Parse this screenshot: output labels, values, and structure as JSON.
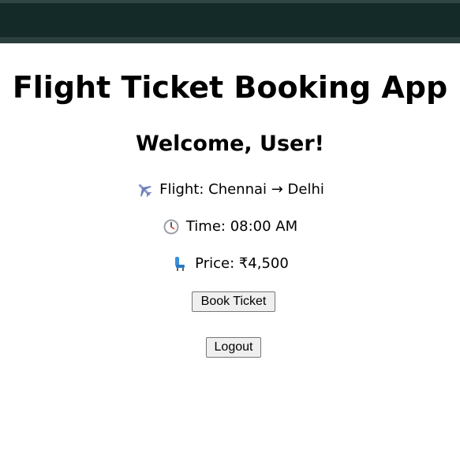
{
  "app": {
    "title": "Flight Ticket Booking App",
    "welcome": "Welcome, User!"
  },
  "flight_info": {
    "flight_label": "Flight: Chennai → Delhi",
    "time_label": "Time: 08:00 AM",
    "price_label": "Price: ₹4,500",
    "flight_icon": "airplane-icon",
    "time_icon": "clock-icon",
    "price_icon": "seat-icon"
  },
  "actions": {
    "book_label": "Book Ticket",
    "logout_label": "Logout"
  },
  "colors": {
    "topbar": "#132a28",
    "background": "#ffffff",
    "text": "#000000",
    "button_bg": "#efefef"
  }
}
